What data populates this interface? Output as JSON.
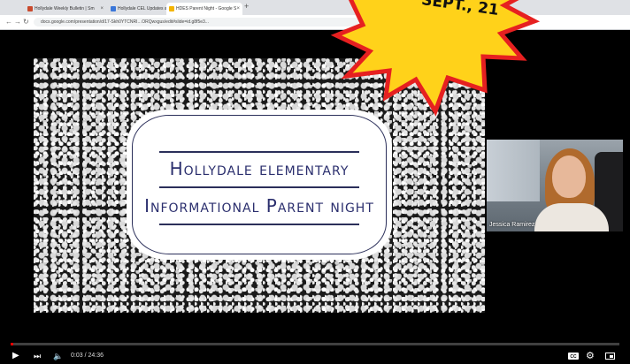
{
  "browser": {
    "tabs": [
      {
        "label": "Hollydale Weekly Bulletin | Sm",
        "fav_color": "#c94a2d",
        "active": false
      },
      {
        "label": "Hollydale CEL Updates and In",
        "fav_color": "#3b77d9",
        "active": false
      },
      {
        "label": "HDES Parent Night - Google S",
        "fav_color": "#f4b400",
        "active": true
      }
    ],
    "url": "docs.google.com/presentation/d/17-Skh0YTCNRl…ORQwxgus/edit#slide=id.g8f5e3..."
  },
  "slide": {
    "title_line1": "Hollydale elementary",
    "title_line2": "Informational Parent night"
  },
  "webcam": {
    "presenter_name": "Jessica Ramirez"
  },
  "badge": {
    "line1": "SEPT., 21",
    "fill_color": "#ffd21a",
    "stroke_color": "#e62020"
  },
  "player": {
    "time_current": "0:03",
    "time_total": "24:36",
    "time_display": "0:03 / 24:36",
    "progress": 0.002,
    "cc_label": "CC"
  },
  "colors": {
    "page_border": "#4a6fa5",
    "progress": "#ff0000"
  }
}
